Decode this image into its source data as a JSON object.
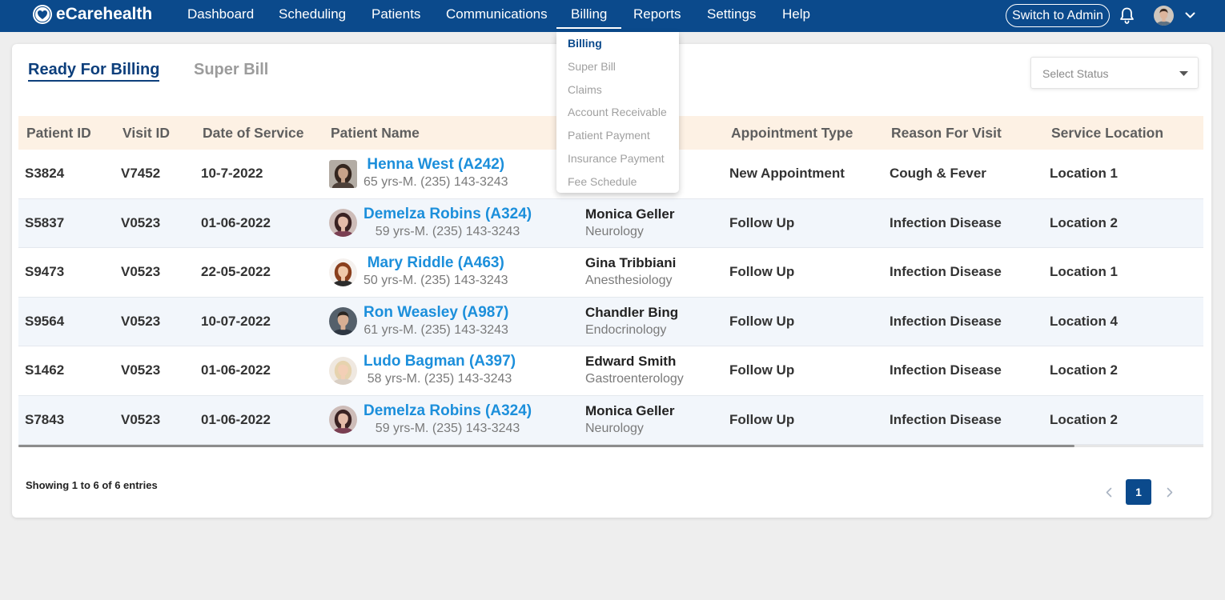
{
  "app": {
    "logo_text": "eCarehealth",
    "logo_icon": "heart-circle-icon"
  },
  "nav": {
    "items": [
      {
        "label": "Dashboard",
        "active": false
      },
      {
        "label": "Scheduling",
        "active": false
      },
      {
        "label": "Patients",
        "active": false
      },
      {
        "label": "Communications",
        "active": false
      },
      {
        "label": "Billing",
        "active": true
      },
      {
        "label": "Reports",
        "active": false
      },
      {
        "label": "Settings",
        "active": false
      },
      {
        "label": "Help",
        "active": false
      }
    ],
    "switch_admin_label": "Switch to Admin",
    "notification_icon": "bell-icon",
    "user_avatar_icon": "user-avatar",
    "user_menu_icon": "chevron-down-icon"
  },
  "billing_menu": {
    "items": [
      {
        "label": "Billing",
        "active": true
      },
      {
        "label": "Super Bill",
        "active": false
      },
      {
        "label": "Claims",
        "active": false
      },
      {
        "label": "Account Receivable",
        "active": false
      },
      {
        "label": "Patient Payment",
        "active": false
      },
      {
        "label": "Insurance Payment",
        "active": false
      },
      {
        "label": "Fee Schedule",
        "active": false
      }
    ]
  },
  "tabs": [
    {
      "label": "Ready For Billing",
      "active": true
    },
    {
      "label": "Super Bill",
      "active": false
    }
  ],
  "status_filter": {
    "placeholder": "Select Status",
    "icon": "caret-down-icon"
  },
  "table": {
    "headers": {
      "patient_id": "Patient ID",
      "visit_id": "Visit ID",
      "date_of_service": "Date of Service",
      "patient_name": "Patient Name",
      "appointment_type": "Appointment Type",
      "reason_for_visit": "Reason For Visit",
      "service_location": "Service Location"
    },
    "rows": [
      {
        "patient_id": "S3824",
        "visit_id": "V7452",
        "date_of_service": "10-7-2022",
        "patient_name": "Henna West (A242)",
        "patient_details": "65 yrs-M. (235) 143-3243",
        "appointment_type": "New Appointment",
        "reason_for_visit": "Cough & Fever",
        "service_location": "Location 1"
      },
      {
        "patient_id": "S5837",
        "visit_id": "V0523",
        "date_of_service": "01-06-2022",
        "patient_name": "Demelza Robins (A324)",
        "patient_details": "59 yrs-M. (235) 143-3243",
        "provider_name": "Monica Geller",
        "provider_specialty": "Neurology",
        "appointment_type": "Follow Up",
        "reason_for_visit": "Infection Disease",
        "service_location": "Location 2"
      },
      {
        "patient_id": "S9473",
        "visit_id": "V0523",
        "date_of_service": "22-05-2022",
        "patient_name": "Mary Riddle (A463)",
        "patient_details": "50 yrs-M. (235) 143-3243",
        "provider_name": "Gina Tribbiani",
        "provider_specialty": "Anesthesiology",
        "appointment_type": "Follow Up",
        "reason_for_visit": "Infection Disease",
        "service_location": "Location 1"
      },
      {
        "patient_id": "S9564",
        "visit_id": "V0523",
        "date_of_service": "10-07-2022",
        "patient_name": "Ron Weasley (A987)",
        "patient_details": "61 yrs-M. (235) 143-3243",
        "provider_name": "Chandler Bing",
        "provider_specialty": "Endocrinology",
        "appointment_type": "Follow Up",
        "reason_for_visit": "Infection Disease",
        "service_location": "Location 4"
      },
      {
        "patient_id": "S1462",
        "visit_id": "V0523",
        "date_of_service": "01-06-2022",
        "patient_name": "Ludo Bagman (A397)",
        "patient_details": "58 yrs-M. (235) 143-3243",
        "provider_name": "Edward Smith",
        "provider_specialty": "Gastroenterology",
        "appointment_type": "Follow Up",
        "reason_for_visit": "Infection Disease",
        "service_location": "Location 2"
      },
      {
        "patient_id": "S7843",
        "visit_id": "V0523",
        "date_of_service": "01-06-2022",
        "patient_name": "Demelza Robins (A324)",
        "patient_details": "59 yrs-M. (235) 143-3243",
        "provider_name": "Monica Geller",
        "provider_specialty": "Neurology",
        "appointment_type": "Follow Up",
        "reason_for_visit": "Infection Disease",
        "service_location": "Location 2"
      }
    ]
  },
  "footer": {
    "entries_text": "Showing 1 to 6 of 6 entries"
  },
  "pagination": {
    "current_page": "1",
    "prev_icon": "chevron-left-icon",
    "next_icon": "chevron-right-icon"
  },
  "colors": {
    "navbar": "#0b4a8c",
    "brand_dark": "#0d3f7c",
    "link": "#1c8fdb",
    "header_bg": "#fdf1e4",
    "row_alt_bg": "#f2f6fb",
    "page_bg": "#eeeeee"
  }
}
